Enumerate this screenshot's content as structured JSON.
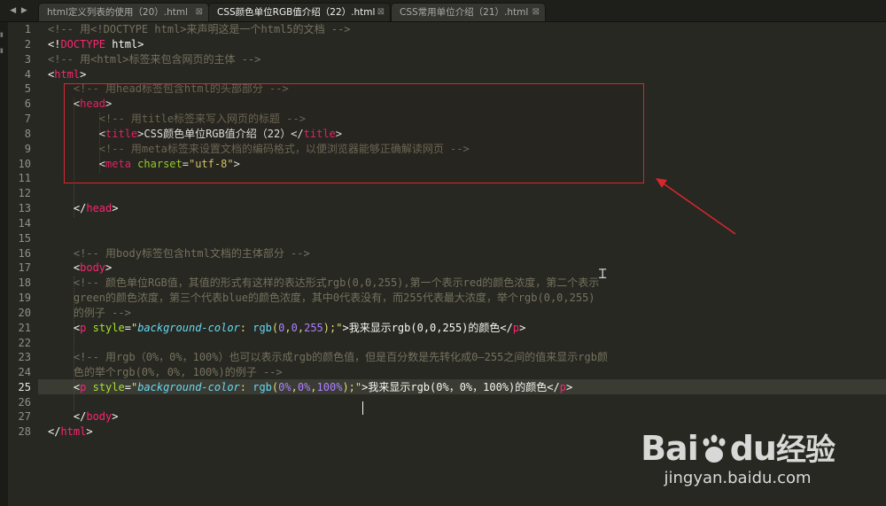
{
  "tabs": [
    {
      "label": "html定义列表的使用（20）.html",
      "active": false
    },
    {
      "label": "CSS颜色单位RGB值介绍（22）.html",
      "active": true
    },
    {
      "label": "CSS常用单位介绍（21）.html",
      "active": false
    }
  ],
  "tab_nav": {
    "prev": "◀",
    "next": "▶"
  },
  "tab_close_glyph": "⊠",
  "line_numbers": [
    "1",
    "2",
    "3",
    "4",
    "5",
    "6",
    "7",
    "8",
    "9",
    "10",
    "11",
    "12",
    "13",
    "14",
    "15",
    "16",
    "17",
    "18",
    "19",
    "20",
    "21",
    "22",
    "23",
    "24",
    "25",
    "26",
    "27",
    "28"
  ],
  "current_line": 25,
  "code": {
    "l1": "<!-- 用<!DOCTYPE html>来声明这是一个html5的文档 -->",
    "l2_open": "<!",
    "l2_kw": "DOCTYPE",
    "l2_rest": " html>",
    "l3": "<!-- 用<html>标签来包含网页的主体 -->",
    "l5": "<!-- 用head标签包含html的头部部分 -->",
    "l7": "<!-- 用title标签来写入网页的标题 -->",
    "l8_text": "CSS颜色单位RGB值介绍（22）",
    "l9": "<!-- 用meta标签来设置文档的编码格式，以便浏览器能够正确解读网页 -->",
    "l10_val": "\"utf-8\"",
    "l16": "<!-- 用body标签包含html文档的主体部分 -->",
    "l18": "<!-- 颜色单位RGB值，其值的形式有这样的表达形式rgb(0,0,255),第一个表示red的颜色浓度，第二个表示",
    "l19": "green的颜色浓度，第三个代表blue的颜色浓度，其中0代表没有，而255代表最大浓度，举个rgb(0,0,255)",
    "l20": "的例子 -->",
    "l21_text": "我来显示rgb(0,0,255)的颜色",
    "l23": "<!-- 用rgb（0%，0%，100%）也可以表示成rgb的颜色值，但是百分数是先转化成0—255之间的值来显示rgb颜",
    "l24": "色的举个rgb(0%, 0%, 100%)的例子 -->",
    "l25_text": "我来显示rgb(0%，0%，100%)的颜色"
  },
  "tokens": {
    "html": "html",
    "head": "head",
    "title": "title",
    "meta": "meta",
    "charset": "charset",
    "body": "body",
    "p": "p",
    "style": "style",
    "bgcolor": "background-color",
    "rgb": "rgb",
    "zero": "0",
    "n255": "255",
    "pct0": "0%",
    "pct100": "100%"
  },
  "watermark": {
    "brand": "Bai",
    "brand2": "du",
    "product": "经验",
    "url": "jingyan.baidu.com"
  },
  "colors": {
    "annotation": "#d9262e",
    "comment": "#75715e",
    "tag": "#f92672",
    "attribute": "#a6e22e",
    "string": "#e6db74"
  }
}
